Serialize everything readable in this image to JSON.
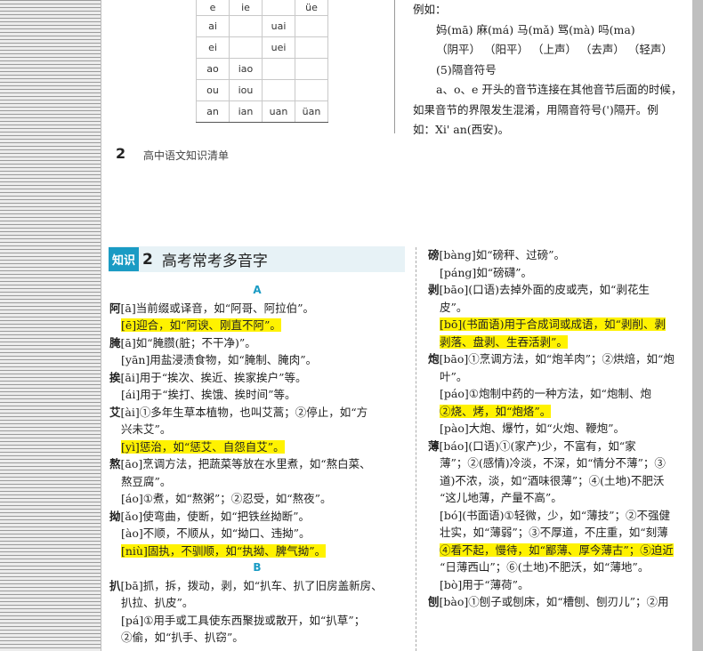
{
  "top_table": {
    "rows": [
      [
        "e",
        "ie",
        "",
        "üe"
      ],
      [
        "ai",
        "",
        "uai",
        ""
      ],
      [
        "ei",
        "",
        "uei",
        ""
      ],
      [
        "ao",
        "iao",
        "",
        ""
      ],
      [
        "ou",
        "iou",
        "",
        ""
      ],
      [
        "an",
        "ian",
        "uan",
        "üan"
      ]
    ]
  },
  "top_right": {
    "lines": [
      "例如：",
      "妈(mā)  麻(má)  马(mǎ)  骂(mà)  吗(ma)",
      "（阴平）  （阳平）  （上声）  （去声）  （轻声）",
      "(5)隔音符号",
      "a、o、e 开头的音节连接在其他音节后面的时候，",
      "如果音节的界限发生混淆，用隔音符号(')隔开。例",
      "如：Xi' an(西安)。"
    ]
  },
  "footer": {
    "page_number": "2",
    "book_title": "高中语文知识清单"
  },
  "section": {
    "tag": "知识",
    "number": "2",
    "title": "高考常考多音字"
  },
  "left_col": [
    {
      "type": "letter",
      "text": "A"
    },
    {
      "type": "head",
      "char": "阿",
      "text": "[ā]当前缀或译音，如“阿哥、阿拉伯”。"
    },
    {
      "type": "hsub",
      "text": "[ē]迎合，如“阿谀、刚直不阿”。"
    },
    {
      "type": "head",
      "char": "腌",
      "text": "[ā]如“腌臜(脏；不干净)”。"
    },
    {
      "type": "sub",
      "text": "[yān]用盐浸渍食物，如“腌制、腌肉”。"
    },
    {
      "type": "head",
      "char": "挨",
      "text": "[āi]用于“挨次、挨近、挨家挨户”等。"
    },
    {
      "type": "sub",
      "text": "[ái]用于“挨打、挨饿、挨时间”等。"
    },
    {
      "type": "head",
      "char": "艾",
      "text": "[ài]①多年生草本植物，也叫艾蒿；②停止，如“方"
    },
    {
      "type": "cont",
      "text": "兴未艾”。"
    },
    {
      "type": "hsub",
      "text": "[yì]惩治，如“惩艾、自怨自艾”。"
    },
    {
      "type": "head",
      "char": "熬",
      "text": "[āo]烹调方法，把蔬菜等放在水里煮，如“熬白菜、"
    },
    {
      "type": "cont",
      "text": "熬豆腐”。"
    },
    {
      "type": "sub",
      "text": "[áo]①煮，如“熬粥”；②忍受，如“熬夜”。"
    },
    {
      "type": "head",
      "char": "拗",
      "text": "[ǎo]使弯曲，使断，如“把铁丝拗断”。"
    },
    {
      "type": "sub",
      "text": "[ào]不顺，不顺从，如“拗口、违拗”。"
    },
    {
      "type": "hsub",
      "text": "[niù]固执，不驯顺，如“执拗、脾气拗”。"
    },
    {
      "type": "letter",
      "text": "B"
    },
    {
      "type": "head",
      "char": "扒",
      "text": "[bā]抓，拆，拨动，剥，如“扒车、扒了旧房盖新房、"
    },
    {
      "type": "cont",
      "text": "扒拉、扒皮”。"
    },
    {
      "type": "sub",
      "text": "[pá]①用手或工具使东西聚拢或散开，如“扒草”；"
    },
    {
      "type": "cont",
      "text": "②偷，如“扒手、扒窃”。"
    }
  ],
  "right_col": [
    {
      "type": "head",
      "char": "磅",
      "text": "[bàng]如“磅秤、过磅”。"
    },
    {
      "type": "sub",
      "text": "[páng]如“磅礴”。"
    },
    {
      "type": "head",
      "char": "剥",
      "text": "[bāo](口语)去掉外面的皮或壳，如“剥花生"
    },
    {
      "type": "cont",
      "text": "皮”。"
    },
    {
      "type": "hsub",
      "text": "[bō](书面语)用于合成词或成语，如“剥削、剥"
    },
    {
      "type": "hcont",
      "text": "剥落、盘剥、生吞活剥”。"
    },
    {
      "type": "head",
      "char": "炮",
      "text": "[bāo]①烹调方法，如“炮羊肉”；②烘焙，如“炮"
    },
    {
      "type": "cont",
      "text": "叶”。"
    },
    {
      "type": "sub",
      "text": "[páo]①炮制中药的一种方法，如“炮制、炮"
    },
    {
      "type": "hcont",
      "text": "②烧、烤，如“炮烙”。"
    },
    {
      "type": "sub",
      "text": "[pào]大炮、爆竹，如“火炮、鞭炮”。"
    },
    {
      "type": "head",
      "char": "薄",
      "text": "[báo](口语)①(家产)少，不富有，如“家"
    },
    {
      "type": "cont",
      "text": "薄”；②(感情)冷淡，不深，如“情分不薄”；③"
    },
    {
      "type": "cont",
      "text": "道)不浓，淡，如“酒味很薄”；④(土地)不肥沃"
    },
    {
      "type": "cont",
      "text": "“这儿地薄，产量不高”。"
    },
    {
      "type": "sub",
      "text": "[bó](书面语)①轻微，少，如“薄技”；②不强健"
    },
    {
      "type": "cont",
      "text": "壮实，如“薄弱”；③不厚道，不庄重，如“刻薄"
    },
    {
      "type": "hcont",
      "text": "④看不起，慢待，如“鄙薄、厚今薄古”；⑤迫近"
    },
    {
      "type": "cont",
      "text": "“日薄西山”；⑥(土地)不肥沃，如“薄地”。"
    },
    {
      "type": "sub",
      "text": "[bò]用于“薄荷”。"
    },
    {
      "type": "head",
      "char": "刨",
      "text": "[bào]①刨子或刨床，如“槽刨、刨刃儿”；②用"
    }
  ]
}
